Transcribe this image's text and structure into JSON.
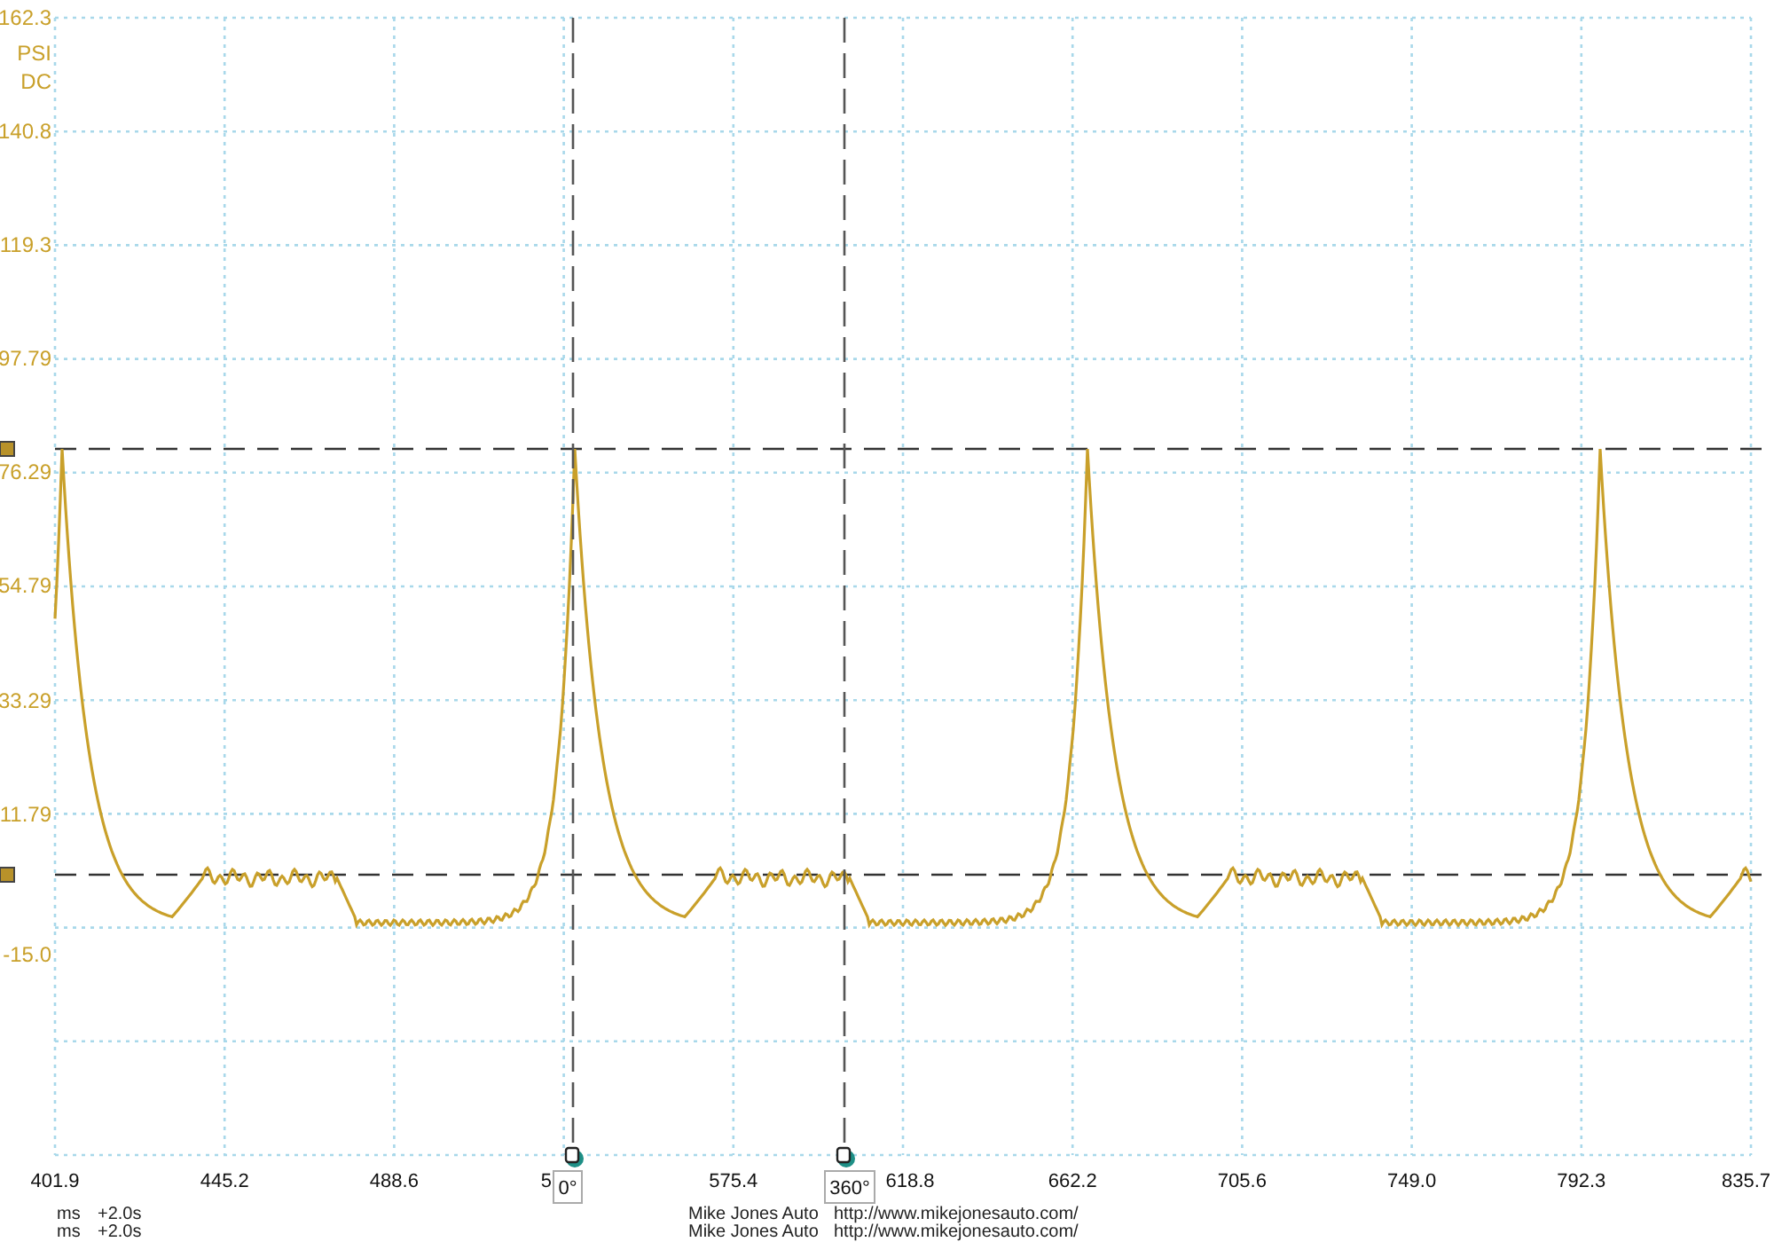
{
  "channel": {
    "unit": "PSI",
    "coupling": "DC",
    "y_ticks": [
      "162.3",
      "140.8",
      "119.3",
      "97.79",
      "76.29",
      "54.79",
      "33.29",
      "11.79",
      "-15.0"
    ]
  },
  "x_ticks": [
    "401.9",
    "445.2",
    "488.6",
    "5",
    "575.4",
    "618.8",
    "662.2",
    "705.6",
    "749.0",
    "792.3",
    "835.7"
  ],
  "phase_cursors": [
    {
      "label": "0°"
    },
    {
      "label": "360°"
    }
  ],
  "footer": [
    {
      "units": "ms",
      "offset": "+2.0s",
      "author": "Mike Jones Auto",
      "url": "http://www.mikejonesauto.com/"
    },
    {
      "units": "ms",
      "offset": "+2.0s",
      "author": "Mike Jones Auto",
      "url": "http://www.mikejonesauto.com/"
    }
  ]
}
